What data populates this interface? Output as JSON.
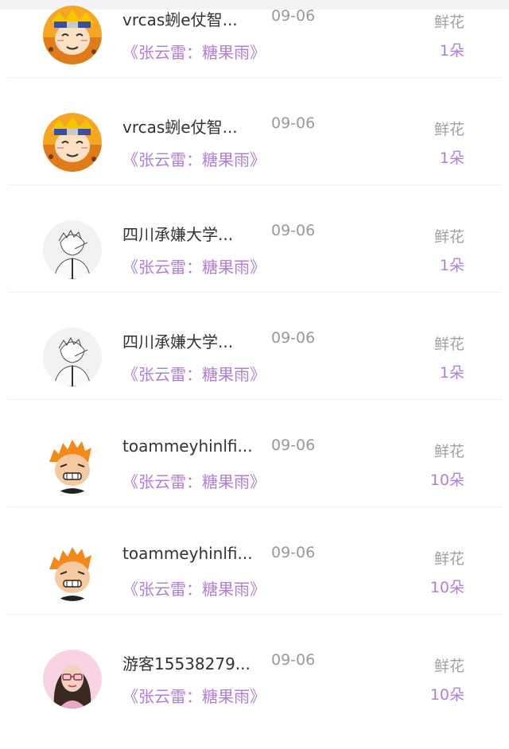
{
  "gifts": [
    {
      "name": "vrcas蛚e仗智...",
      "date": "09-06",
      "song": "《张云雷：糖果雨》",
      "gift_label": "鲜花",
      "gift_count": "1朵",
      "avatar": "naruto-avatar"
    },
    {
      "name": "vrcas蛚e仗智...",
      "date": "09-06",
      "song": "《张云雷：糖果雨》",
      "gift_label": "鲜花",
      "gift_count": "1朵",
      "avatar": "naruto-avatar"
    },
    {
      "name": "四川承嫌大学...",
      "date": "09-06",
      "song": "《张云雷：糖果雨》",
      "gift_label": "鲜花",
      "gift_count": "1朵",
      "avatar": "sketch-avatar"
    },
    {
      "name": "四川承嫌大学...",
      "date": "09-06",
      "song": "《张云雷：糖果雨》",
      "gift_label": "鲜花",
      "gift_count": "1朵",
      "avatar": "sketch-avatar"
    },
    {
      "name": "toammeyhinlfi...",
      "date": "09-06",
      "song": "《张云雷：糖果雨》",
      "gift_label": "鲜花",
      "gift_count": "10朵",
      "avatar": "ichigo-avatar"
    },
    {
      "name": "toammeyhinlfi...",
      "date": "09-06",
      "song": "《张云雷：糖果雨》",
      "gift_label": "鲜花",
      "gift_count": "10朵",
      "avatar": "ichigo-avatar"
    },
    {
      "name": "游客15538279...",
      "date": "09-06",
      "song": "《张云雷：糖果雨》",
      "gift_label": "鲜花",
      "gift_count": "10朵",
      "avatar": "girl-avatar"
    }
  ]
}
